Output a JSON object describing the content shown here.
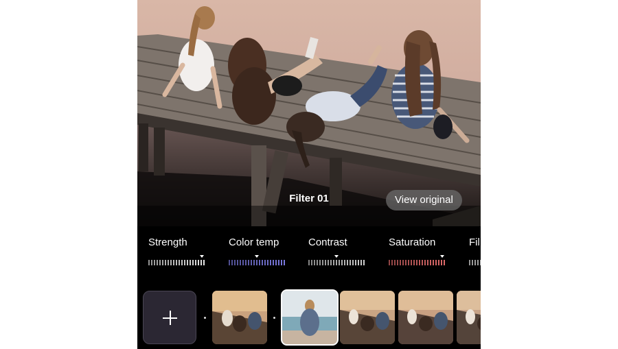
{
  "editor": {
    "filter_name": "Filter 01",
    "view_original_label": "View original",
    "adjustments": [
      {
        "label": "Strength",
        "color": "#e6e6e6",
        "level": 0.95
      },
      {
        "label": "Color temp",
        "color": "#7b7ae0",
        "level": 0.5
      },
      {
        "label": "Contrast",
        "color": "#cfcfcf",
        "level": 0.5
      },
      {
        "label": "Saturation",
        "color": "#e06b6b",
        "level": 0.95
      },
      {
        "label": "Fil",
        "color": "#e6e6e6",
        "level": 0.5
      }
    ],
    "thumbnails": {
      "add_icon": "plus-icon",
      "selected_index": 1,
      "count": 6
    }
  }
}
